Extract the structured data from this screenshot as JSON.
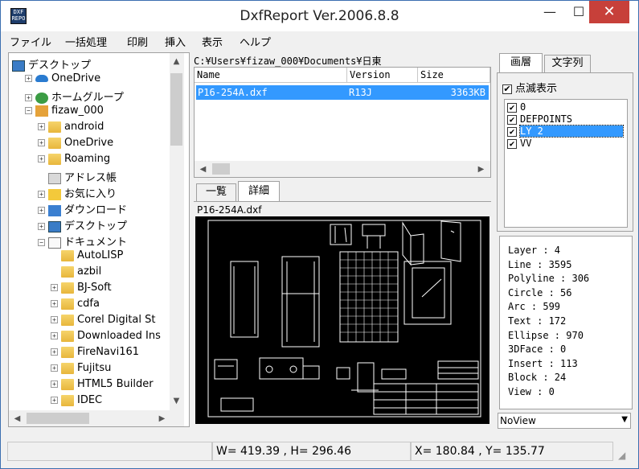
{
  "window": {
    "title": "DxfReport Ver.2006.8.8",
    "icon_text_1": "DXF",
    "icon_text_2": "REPO",
    "min_glyph": "—",
    "max_glyph": "☐",
    "close_glyph": "✕"
  },
  "menu": [
    "ファイル",
    "一括処理",
    "印刷",
    "挿入",
    "表示",
    "ヘルプ"
  ],
  "tree": {
    "items": [
      {
        "label": "デスクトップ",
        "icon": "desktop-icon"
      },
      {
        "label": "OneDrive",
        "icon": "cloud-icon"
      },
      {
        "label": "ホームグループ",
        "icon": "homegroup-icon"
      },
      {
        "label": "fizaw_000",
        "icon": "user-folder-icon"
      },
      {
        "label": "android",
        "icon": "folder-icon"
      },
      {
        "label": "OneDrive",
        "icon": "cloud-folder-icon"
      },
      {
        "label": "Roaming",
        "icon": "folder-icon"
      },
      {
        "label": "アドレス帳",
        "icon": "address-book-icon"
      },
      {
        "label": "お気に入り",
        "icon": "favorites-icon"
      },
      {
        "label": "ダウンロード",
        "icon": "download-icon"
      },
      {
        "label": "デスクトップ",
        "icon": "desktop-folder-icon"
      },
      {
        "label": "ドキュメント",
        "icon": "documents-icon"
      },
      {
        "label": "AutoLISP",
        "icon": "folder-icon"
      },
      {
        "label": "azbil",
        "icon": "folder-icon"
      },
      {
        "label": "BJ-Soft",
        "icon": "folder-icon"
      },
      {
        "label": "cdfa",
        "icon": "folder-icon"
      },
      {
        "label": "Corel Digital St",
        "icon": "folder-icon"
      },
      {
        "label": "Downloaded Ins",
        "icon": "folder-icon"
      },
      {
        "label": "FireNavi161",
        "icon": "folder-icon"
      },
      {
        "label": "Fujitsu",
        "icon": "folder-icon"
      },
      {
        "label": "HTML5 Builder",
        "icon": "folder-icon"
      },
      {
        "label": "IDEC",
        "icon": "folder-icon"
      }
    ]
  },
  "filelist": {
    "path": "C:¥Users¥fizaw_000¥Documents¥日東",
    "columns": [
      "Name",
      "Version",
      "Size"
    ],
    "rows": [
      {
        "name": "P16-254A.dxf",
        "version": "R13J",
        "size": "3363KB"
      }
    ]
  },
  "preview": {
    "tabs": [
      "一覧",
      "詳細"
    ],
    "active_tab": "詳細",
    "filename": "P16-254A.dxf"
  },
  "layers": {
    "tabs": [
      "画層",
      "文字列"
    ],
    "blink_label": "点滅表示",
    "items": [
      {
        "name": "0",
        "checked": true
      },
      {
        "name": "DEFPOINTS",
        "checked": true
      },
      {
        "name": "LY 2",
        "checked": true,
        "selected": true
      },
      {
        "name": "VV",
        "checked": true
      }
    ]
  },
  "stats": [
    "Layer : 4",
    "Line : 3595",
    "Polyline : 306",
    "Circle : 56",
    "Arc : 599",
    "Text : 172",
    "Ellipse : 970",
    "3DFace : 0",
    "Insert : 113",
    "Block : 24",
    "View : 0"
  ],
  "view_select": {
    "value": "NoView"
  },
  "status": {
    "size": "W= 419.39 , H= 296.46",
    "coords": "X= 180.84 , Y= 135.77"
  },
  "colors": {
    "selection": "#3399ff",
    "close_button": "#c7403a",
    "cad_background": "#000000",
    "cad_lines": "#ffffff"
  }
}
